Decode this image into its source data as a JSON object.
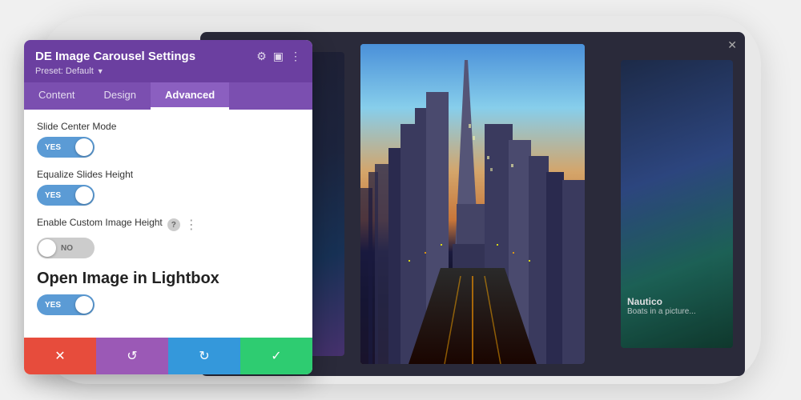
{
  "page": {
    "background_color": "#e8e8e8"
  },
  "panel": {
    "title": "DE Image Carousel Settings",
    "preset_label": "Preset: Default",
    "preset_arrow": "▼",
    "tabs": [
      {
        "id": "content",
        "label": "Content",
        "active": false
      },
      {
        "id": "design",
        "label": "Design",
        "active": false
      },
      {
        "id": "advanced",
        "label": "Advanced",
        "active": true
      }
    ],
    "settings": {
      "slide_center_mode": {
        "label": "Slide Center Mode",
        "value": "YES",
        "enabled": true
      },
      "equalize_slides_height": {
        "label": "Equalize Slides Height",
        "value": "YES",
        "enabled": true
      },
      "enable_custom_image_height": {
        "label": "Enable Custom Image Height",
        "value": "NO",
        "enabled": false
      },
      "open_image_lightbox": {
        "title": "Open Image in Lightbox",
        "value": "YES",
        "enabled": true
      }
    },
    "actions": {
      "cancel_label": "✕",
      "undo_label": "↺",
      "redo_label": "↻",
      "save_label": "✓"
    }
  },
  "carousel": {
    "close_icon": "✕"
  },
  "right_overlay": {
    "title": "Nautico",
    "subtitle": "Boats in a picture..."
  },
  "icons": {
    "help": "?",
    "more": "⋮",
    "settings": "⚙",
    "layout": "▣",
    "more_vert": "⋮"
  }
}
